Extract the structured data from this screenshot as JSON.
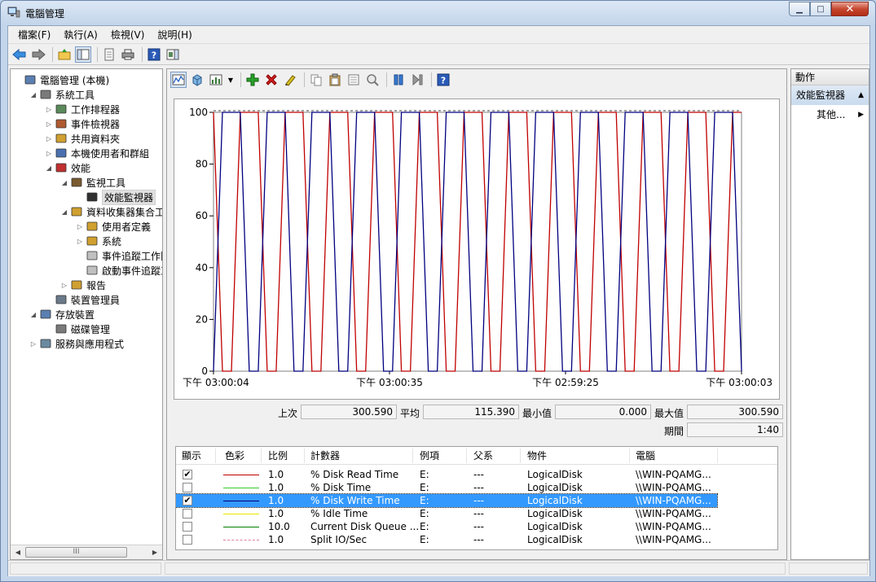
{
  "window": {
    "title": "電腦管理"
  },
  "menu": [
    "檔案(F)",
    "執行(A)",
    "檢視(V)",
    "說明(H)"
  ],
  "tree": [
    {
      "label": "電腦管理 (本機)",
      "level": 0,
      "arrow": "",
      "icon": "computer-management-icon"
    },
    {
      "label": "系統工具",
      "level": 1,
      "arrow": "◢",
      "icon": "system-tools-icon"
    },
    {
      "label": "工作排程器",
      "level": 2,
      "arrow": "▷",
      "icon": "task-scheduler-icon"
    },
    {
      "label": "事件檢視器",
      "level": 2,
      "arrow": "▷",
      "icon": "event-viewer-icon"
    },
    {
      "label": "共用資料夾",
      "level": 2,
      "arrow": "▷",
      "icon": "shared-folders-icon"
    },
    {
      "label": "本機使用者和群組",
      "level": 2,
      "arrow": "▷",
      "icon": "local-users-icon"
    },
    {
      "label": "效能",
      "level": 2,
      "arrow": "◢",
      "icon": "performance-icon"
    },
    {
      "label": "監視工具",
      "level": 3,
      "arrow": "◢",
      "icon": "monitoring-tools-icon"
    },
    {
      "label": "效能監視器",
      "level": 4,
      "arrow": "",
      "icon": "performance-monitor-icon",
      "selected": true
    },
    {
      "label": "資料收集器集合工具",
      "level": 3,
      "arrow": "◢",
      "icon": "data-collector-sets-icon"
    },
    {
      "label": "使用者定義",
      "level": 4,
      "arrow": "▷",
      "icon": "user-defined-icon"
    },
    {
      "label": "系統",
      "level": 4,
      "arrow": "▷",
      "icon": "system-folder-icon"
    },
    {
      "label": "事件追蹤工作階",
      "level": 4,
      "arrow": "",
      "icon": "event-trace-icon"
    },
    {
      "label": "啟動事件追蹤工",
      "level": 4,
      "arrow": "",
      "icon": "startup-trace-icon"
    },
    {
      "label": "報告",
      "level": 3,
      "arrow": "▷",
      "icon": "reports-icon"
    },
    {
      "label": "裝置管理員",
      "level": 2,
      "arrow": "",
      "icon": "device-manager-icon"
    },
    {
      "label": "存放裝置",
      "level": 1,
      "arrow": "◢",
      "icon": "storage-icon"
    },
    {
      "label": "磁碟管理",
      "level": 2,
      "arrow": "",
      "icon": "disk-management-icon"
    },
    {
      "label": "服務與應用程式",
      "level": 1,
      "arrow": "▷",
      "icon": "services-apps-icon"
    }
  ],
  "stats": {
    "last_label": "上次",
    "last": "300.590",
    "avg_label": "平均",
    "avg": "115.390",
    "min_label": "最小值",
    "min": "0.000",
    "max_label": "最大值",
    "max": "300.590",
    "duration_label": "期間",
    "duration": "1:40"
  },
  "counters": {
    "headers": [
      "顯示",
      "色彩",
      "比例",
      "計數器",
      "例項",
      "父系",
      "物件",
      "電腦"
    ],
    "rows": [
      {
        "show": true,
        "color": "#c00000",
        "dash": false,
        "scale": "1.0",
        "counter": "% Disk Read Time",
        "instance": "E:",
        "parent": "---",
        "object": "LogicalDisk",
        "computer": "\\\\WIN-PQAMG..."
      },
      {
        "show": false,
        "color": "#33cc33",
        "dash": false,
        "scale": "1.0",
        "counter": "% Disk Time",
        "instance": "E:",
        "parent": "---",
        "object": "LogicalDisk",
        "computer": "\\\\WIN-PQAMG..."
      },
      {
        "show": true,
        "color": "#000080",
        "dash": false,
        "scale": "1.0",
        "counter": "% Disk Write Time",
        "instance": "E:",
        "parent": "---",
        "object": "LogicalDisk",
        "computer": "\\\\WIN-PQAMG...",
        "selected": true
      },
      {
        "show": false,
        "color": "#e8e800",
        "dash": false,
        "scale": "1.0",
        "counter": "% Idle Time",
        "instance": "E:",
        "parent": "---",
        "object": "LogicalDisk",
        "computer": "\\\\WIN-PQAMG..."
      },
      {
        "show": false,
        "color": "#008000",
        "dash": false,
        "scale": "10.0",
        "counter": "Current Disk Queue ...",
        "instance": "E:",
        "parent": "---",
        "object": "LogicalDisk",
        "computer": "\\\\WIN-PQAMG..."
      },
      {
        "show": false,
        "color": "#e080a0",
        "dash": true,
        "scale": "1.0",
        "counter": "Split IO/Sec",
        "instance": "E:",
        "parent": "---",
        "object": "LogicalDisk",
        "computer": "\\\\WIN-PQAMG..."
      }
    ]
  },
  "actions": {
    "header": "動作",
    "section": "效能監視器",
    "more": "其他..."
  },
  "scroll_grip": "III",
  "chart_data": {
    "type": "line",
    "ylim": [
      0,
      100
    ],
    "y_ticks": [
      "0",
      "20",
      "40",
      "60",
      "80",
      "100"
    ],
    "x_labels": [
      "下午 03:00:04",
      "下午 03:00:35",
      "下午 02:59:25",
      "下午 03:00:03"
    ],
    "series": [
      {
        "color": "#c00000",
        "values": [
          100,
          0,
          0,
          100,
          100,
          100,
          0,
          0,
          100,
          100,
          100,
          0,
          0,
          100,
          100,
          100,
          0,
          0,
          100,
          100,
          100,
          0,
          0,
          100,
          100,
          100,
          0,
          0,
          100,
          100,
          100,
          0,
          0,
          100,
          100,
          100,
          0,
          0,
          100,
          100,
          100,
          0,
          0,
          100,
          100,
          100,
          0,
          0,
          100,
          100,
          100,
          0,
          0,
          100,
          100,
          100,
          0,
          0,
          100,
          100
        ]
      },
      {
        "color": "#000080",
        "values": [
          0,
          100,
          100,
          100,
          0,
          0,
          100,
          100,
          100,
          0,
          0,
          100,
          100,
          100,
          0,
          0,
          100,
          100,
          100,
          0,
          0,
          100,
          100,
          100,
          0,
          0,
          100,
          100,
          100,
          0,
          0,
          100,
          100,
          100,
          0,
          0,
          100,
          100,
          100,
          0,
          0,
          100,
          100,
          100,
          0,
          0,
          100,
          100,
          100,
          0,
          0,
          100,
          100,
          100,
          0,
          0,
          100,
          100,
          100,
          0
        ]
      }
    ]
  }
}
